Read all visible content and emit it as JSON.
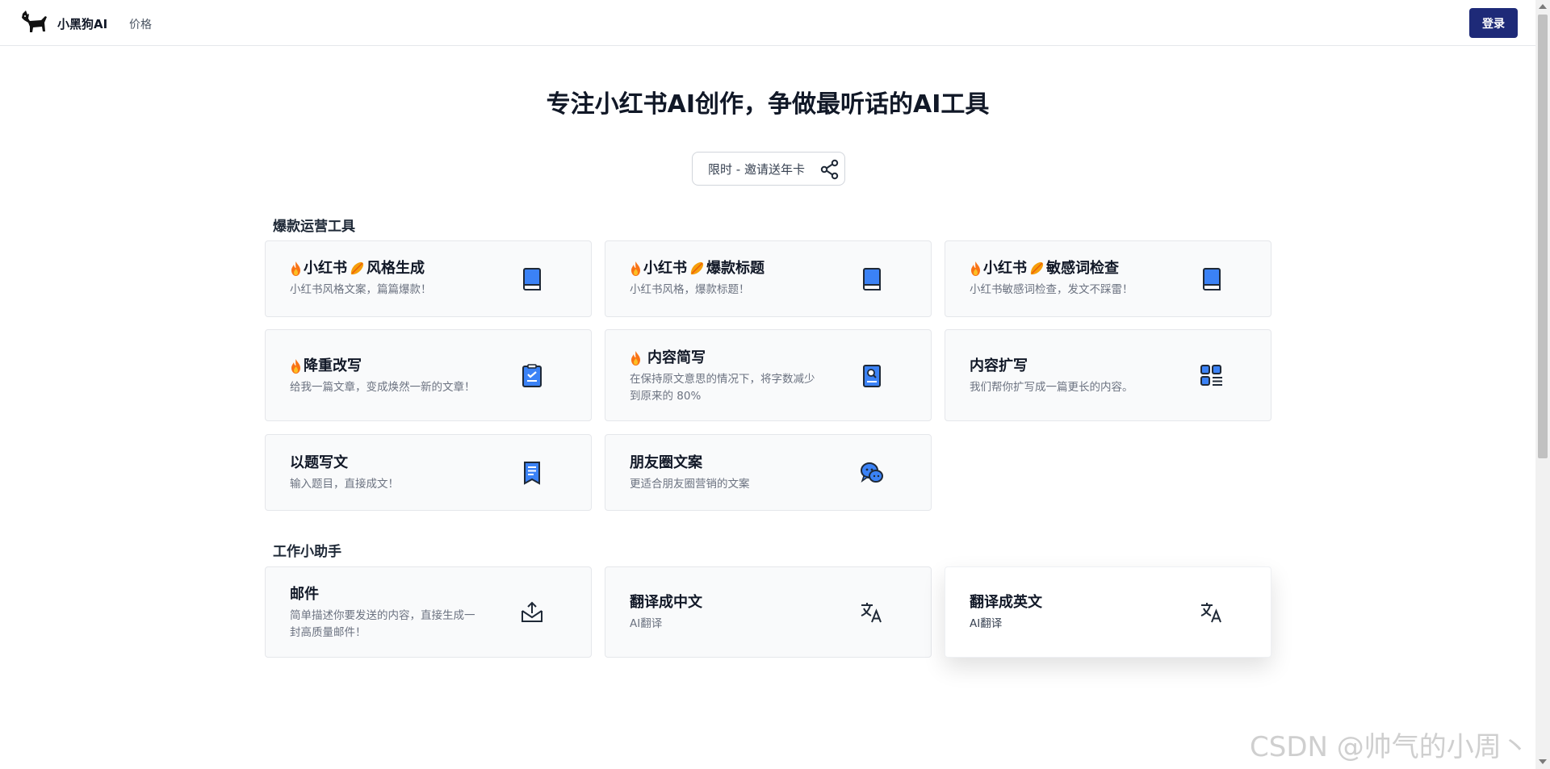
{
  "header": {
    "brand": "小黑狗AI",
    "nav_price": "价格",
    "login_label": "登录"
  },
  "hero": {
    "title": "专注小红书AI创作，争做最听话的AI工具",
    "invite_label": "限时 - 邀请送年卡"
  },
  "sections": [
    {
      "title": "爆款运营工具",
      "cards": [
        {
          "t1": "小红书",
          "t2": "风格生成",
          "desc": "小红书风格文案，篇篇爆款！",
          "icon": "book-icon"
        },
        {
          "t1": "小红书",
          "t2": "爆款标题",
          "desc": "小红书风格，爆款标题！",
          "icon": "book-icon"
        },
        {
          "t1": "小红书",
          "t2": "敏感词检查",
          "desc": "小红书敏感词检查，发文不踩雷！",
          "icon": "book-icon"
        },
        {
          "t1": "降重改写",
          "desc": "给我一篇文章，变成焕然一新的文章！",
          "icon": "clipboard-check-icon"
        },
        {
          "t1": "内容简写",
          "desc1": "在保持原文意思的情况下，将字数减少",
          "desc2": "到原来的 80%",
          "icon": "document-search-icon"
        },
        {
          "t1": "内容扩写",
          "desc": "我们帮你扩写成一篇更长的内容。",
          "icon": "grid-list-icon"
        },
        {
          "t1": "以题写文",
          "desc": "输入题目，直接成文！",
          "icon": "receipt-icon"
        },
        {
          "t1": "朋友圈文案",
          "desc": "更适合朋友圈营销的文案",
          "icon": "chat-bubbles-icon"
        }
      ]
    },
    {
      "title": "工作小助手",
      "cards": [
        {
          "t1": "邮件",
          "desc1": "简单描述你要发送的内容，直接生成一",
          "desc2": "封高质量邮件！",
          "icon": "mail-upload-icon"
        },
        {
          "t1": "翻译成中文",
          "desc": "AI翻译",
          "icon": "translate-icon"
        },
        {
          "t1": "翻译成英文",
          "desc": "AI翻译",
          "icon": "translate-icon"
        }
      ]
    }
  ],
  "watermark": "CSDN @帅气的小周丶",
  "colors": {
    "primary": "#1e2a78",
    "icon_blue": "#3b82f6",
    "icon_dark": "#1f2937"
  }
}
